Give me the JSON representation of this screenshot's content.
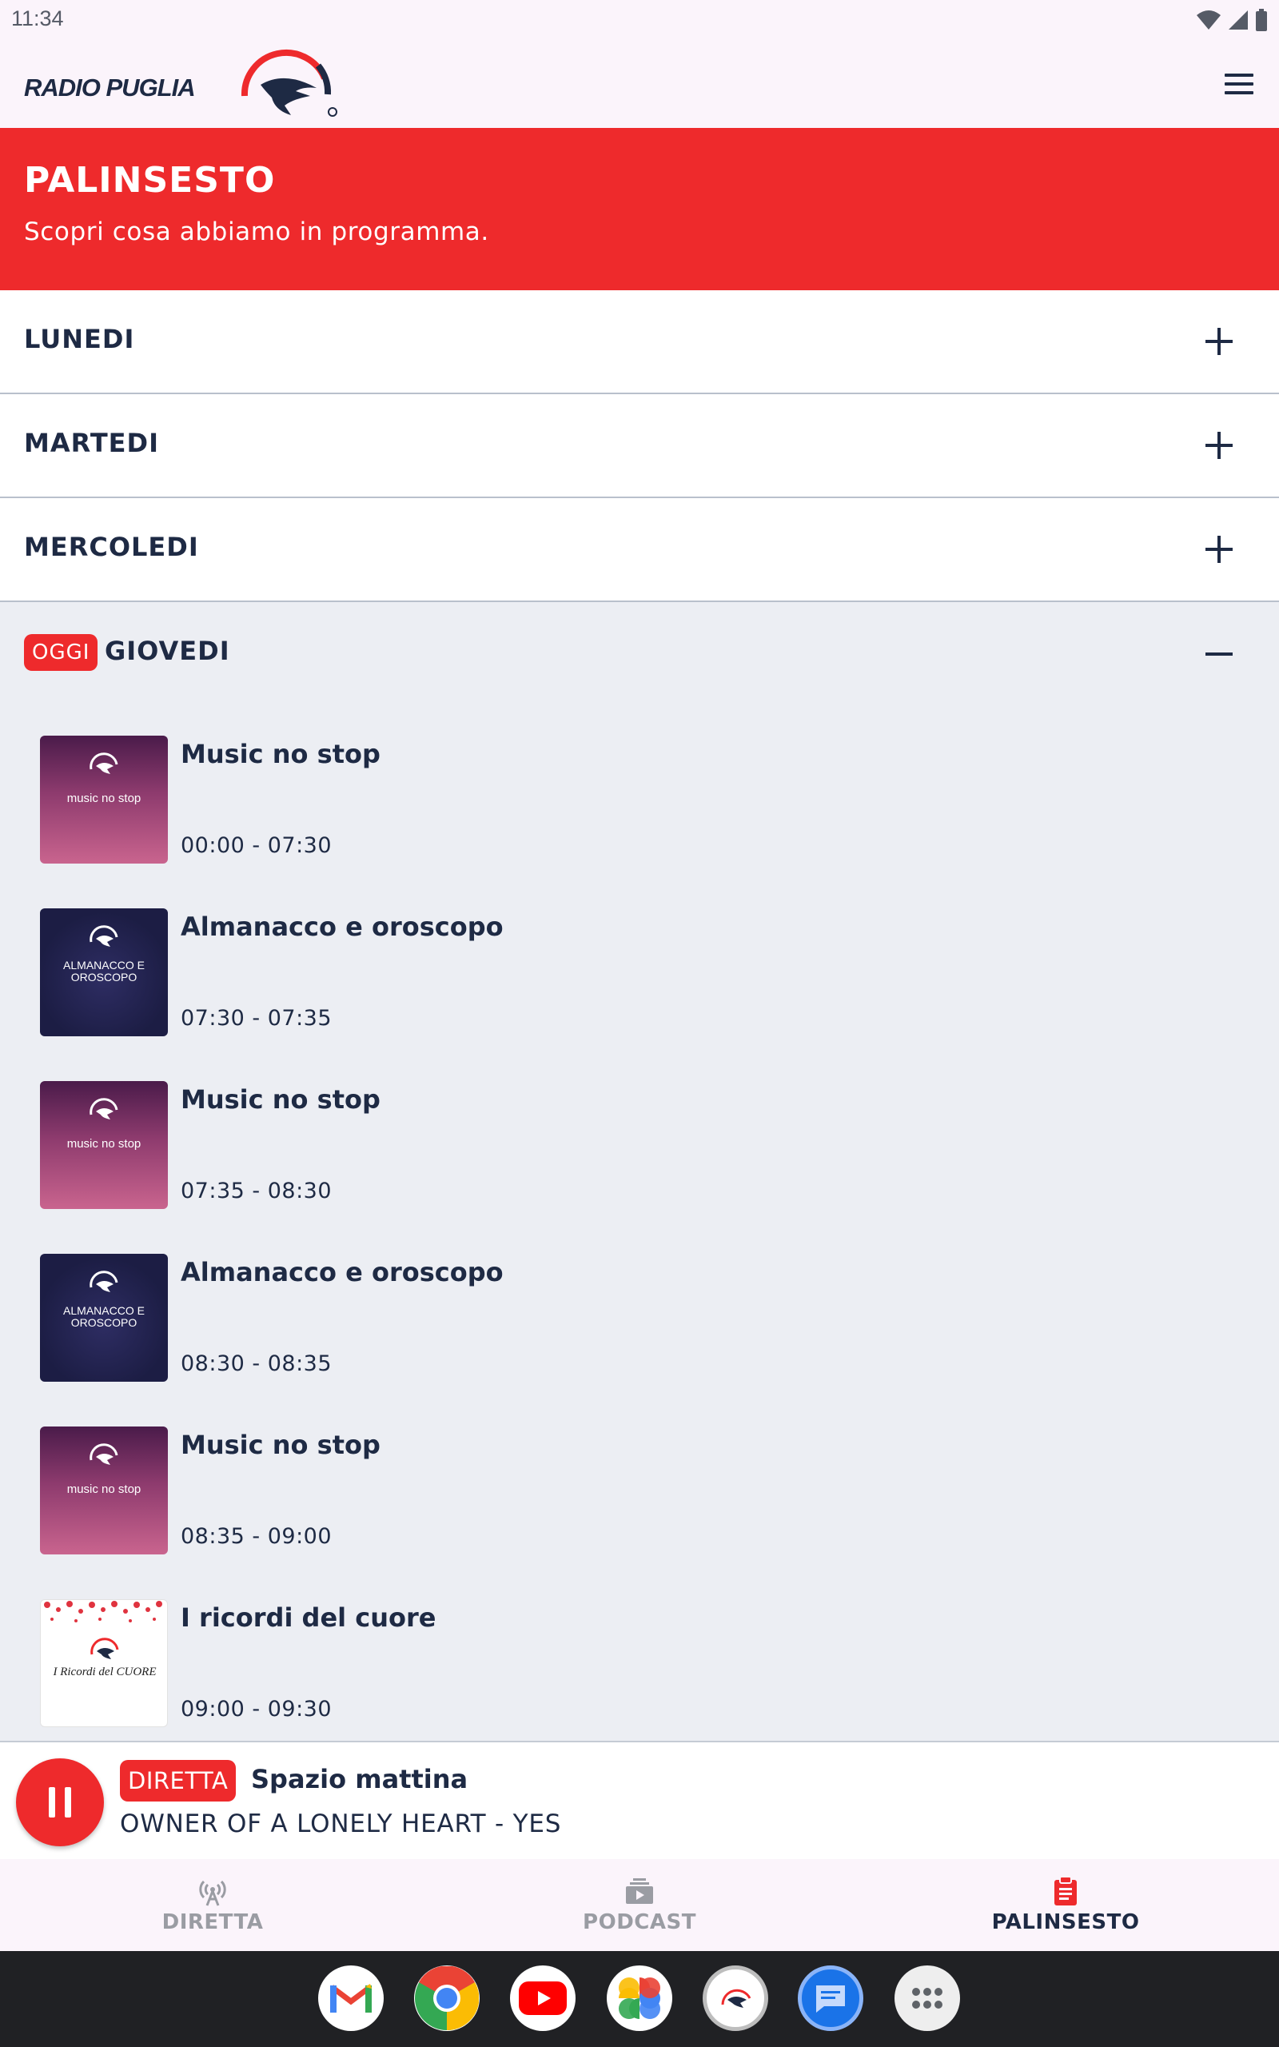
{
  "status_bar": {
    "time": "11:34"
  },
  "header": {
    "logo_text": "RADIO PUGLIA"
  },
  "banner": {
    "title": "PALINSESTO",
    "subtitle": "Scopri cosa abbiamo in programma."
  },
  "days": [
    {
      "label": "LUNEDI"
    },
    {
      "label": "MARTEDI"
    },
    {
      "label": "MERCOLEDI"
    }
  ],
  "today": {
    "badge": "OGGI",
    "label": "GIOVEDI",
    "programs": [
      {
        "title": "Music no stop",
        "time": "00:00 - 07:30",
        "thumb_caption": "music no stop"
      },
      {
        "title": "Almanacco e oroscopo",
        "time": "07:30 - 07:35",
        "thumb_caption": "ALMANACCO E OROSCOPO"
      },
      {
        "title": "Music no stop",
        "time": "07:35 - 08:30",
        "thumb_caption": "music no stop"
      },
      {
        "title": "Almanacco e oroscopo",
        "time": "08:30 - 08:35",
        "thumb_caption": "ALMANACCO E OROSCOPO"
      },
      {
        "title": "Music no stop",
        "time": "08:35 - 09:00",
        "thumb_caption": "music no stop"
      },
      {
        "title": "I ricordi del cuore",
        "time": "09:00 - 09:30",
        "thumb_caption": "I Ricordi del CUORE"
      }
    ]
  },
  "player": {
    "live_badge": "DIRETTA",
    "show": "Spazio mattina",
    "track": "OWNER OF A LONELY HEART - YES"
  },
  "nav": {
    "items": [
      {
        "label": "DIRETTA",
        "icon": "antenna-icon",
        "active": false
      },
      {
        "label": "PODCAST",
        "icon": "podcast-icon",
        "active": false
      },
      {
        "label": "PALINSESTO",
        "icon": "clipboard-icon",
        "active": true
      }
    ]
  },
  "taskbar": {
    "apps": [
      "gmail-icon",
      "chrome-icon",
      "youtube-icon",
      "photos-icon",
      "radio-puglia-icon",
      "messages-icon",
      "app-drawer-icon"
    ]
  },
  "colors": {
    "brand_red": "#ee2a2c",
    "navy": "#1e2a44",
    "section_bg": "#eceef3"
  }
}
